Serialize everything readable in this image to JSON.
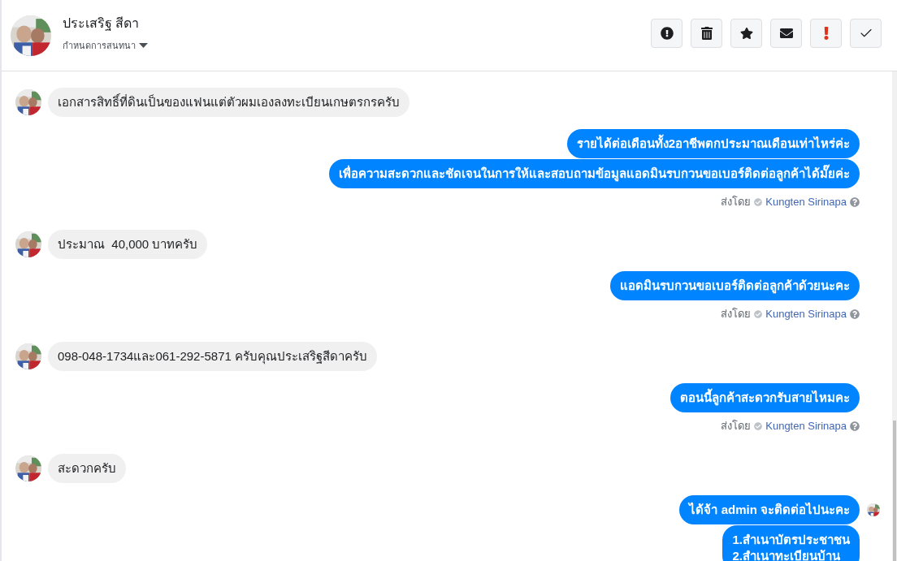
{
  "header": {
    "name": "ประเสริฐ สีดา",
    "subtitle": "กำหนดการสนทนา"
  },
  "actions": [
    {
      "kind": "alert"
    },
    {
      "kind": "delete"
    },
    {
      "kind": "star"
    },
    {
      "kind": "mail"
    },
    {
      "kind": "important"
    },
    {
      "kind": "done"
    }
  ],
  "messages": [
    {
      "kind": "received",
      "text": "เอกสารสิทธิ์ที่ดินเป็นของแฟนแต่ตัวผมเองลงทะเบียนเกษตรกรครับ"
    },
    {
      "kind": "sent",
      "text": "รายได้ต่อเดือนทั้ง2อาชีพตกประมาณเดือนเท่าไหร่ค่ะ"
    },
    {
      "kind": "sent",
      "text": "เพื่อความสะดวกและชัดเจนในการให้และสอบถามข้อมูลแอดมินรบกวนขอเบอร์ติดต่อลูกค้าได้มั๊ยค่ะ"
    },
    {
      "kind": "sender",
      "label": "ส่งโดย",
      "name": "Kungten Sirinapa"
    },
    {
      "kind": "received",
      "text": "ประมาณ  40,000 บาทครับ"
    },
    {
      "kind": "sent",
      "text": "แอดมินรบกวนขอเบอร์ติดต่อลูกค้าด้วยนะคะ"
    },
    {
      "kind": "sender",
      "label": "ส่งโดย",
      "name": "Kungten Sirinapa"
    },
    {
      "kind": "received",
      "text": "098-048-1734และ061-292-5871 ครับคุณประเสริฐสีดาครับ"
    },
    {
      "kind": "sent",
      "text": "ตอนนี้ลูกค้าสะดวกรับสายไหมคะ"
    },
    {
      "kind": "sender",
      "label": "ส่งโดย",
      "name": "Kungten Sirinapa"
    },
    {
      "kind": "received",
      "text": "สะดวกครับ"
    },
    {
      "kind": "sent",
      "text": "ได้จ้า admin จะติดต่อไปนะคะ",
      "seen": true
    },
    {
      "kind": "sent",
      "text": "1.สำเนาบัตรประชาชน\n2.สำเนาทะเบียนบ้าน"
    }
  ]
}
